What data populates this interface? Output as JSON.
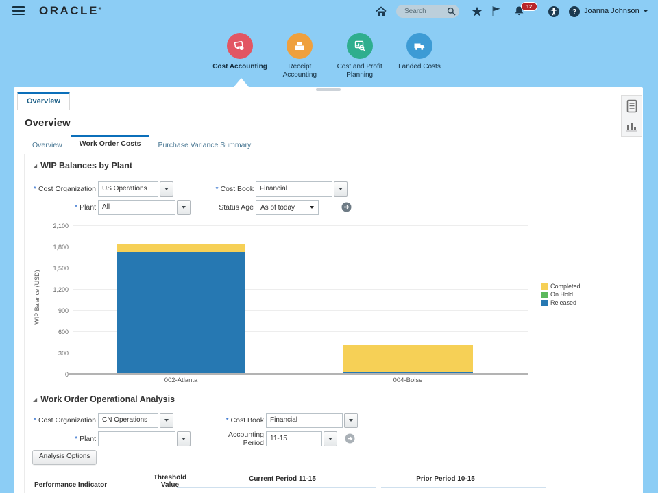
{
  "header": {
    "brand": "ORACLE",
    "brand_mark": "®",
    "search_placeholder": "Search",
    "notification_count": "12",
    "help_glyph": "?",
    "user_name": "Joanna Johnson"
  },
  "apps": [
    {
      "id": "cost-accounting",
      "label": "Cost Accounting",
      "color": "#e25663",
      "active": true
    },
    {
      "id": "receipt-accounting",
      "label": "Receipt Accounting",
      "color": "#efa03d",
      "active": false
    },
    {
      "id": "cost-profit-planning",
      "label": "Cost and Profit Planning",
      "color": "#2fae8e",
      "active": false
    },
    {
      "id": "landed-costs",
      "label": "Landed Costs",
      "color": "#3d9bd5",
      "active": false
    }
  ],
  "window_tab": {
    "label": "Overview"
  },
  "page_title": "Overview",
  "icons": {
    "disclosure": "◢"
  },
  "subtabs": [
    {
      "label": "Overview",
      "active": false
    },
    {
      "label": "Work Order Costs",
      "active": true
    },
    {
      "label": "Purchase Variance Summary",
      "active": false
    }
  ],
  "wip": {
    "title": "WIP Balances by Plant",
    "filters": [
      {
        "label": "Cost Organization",
        "value": "US Operations",
        "required": true
      },
      {
        "label": "Cost Book",
        "value": "Financial",
        "required": true
      },
      {
        "label": "Plant",
        "value": "All",
        "required": true
      },
      {
        "label": "Status Age",
        "value": "As of today",
        "required": false
      }
    ]
  },
  "chart_data": {
    "type": "bar",
    "stacked": true,
    "categories": [
      "002-Atlanta",
      "004-Boise"
    ],
    "series": [
      {
        "name": "Completed",
        "color": "#f6d056",
        "values": [
          120,
          390
        ]
      },
      {
        "name": "On Hold",
        "color": "#5cb85c",
        "values": [
          0,
          0
        ]
      },
      {
        "name": "Released",
        "color": "#2678b2",
        "values": [
          1720,
          20
        ]
      }
    ],
    "ylabel": "WIP Balance (USD)",
    "xlabel": "",
    "ylim": [
      0,
      2100
    ],
    "yticks": [
      0,
      300,
      600,
      900,
      1200,
      1500,
      1800,
      2100
    ],
    "ytick_labels": [
      "0",
      "300",
      "600",
      "900",
      "1,200",
      "1,500",
      "1,800",
      "2,100"
    ],
    "grid": true,
    "legend_position": "right"
  },
  "woa": {
    "title": "Work Order Operational Analysis",
    "filters": [
      {
        "label": "Cost Organization",
        "value": "CN Operations",
        "required": true
      },
      {
        "label": "Cost Book",
        "value": "Financial",
        "required": true
      },
      {
        "label": "Plant",
        "value": "",
        "required": true
      },
      {
        "label": "Accounting Period",
        "value": "11-15",
        "required": false
      }
    ],
    "analysis_button": "Analysis Options"
  },
  "table": {
    "performance_indicator": "Performance Indicator",
    "threshold_line1": "Threshold",
    "threshold_line2": "Value",
    "current_group": "Current Period 11-15",
    "prior_group": "Prior Period 10-15"
  },
  "colors": {
    "background": "#8ccdf5",
    "tab_accent": "#0b6fba",
    "header_icon": "#1c3a50",
    "badge_red": "#b8262a",
    "go_dark": "#6e7b85",
    "go_light": "#aab1b7"
  }
}
